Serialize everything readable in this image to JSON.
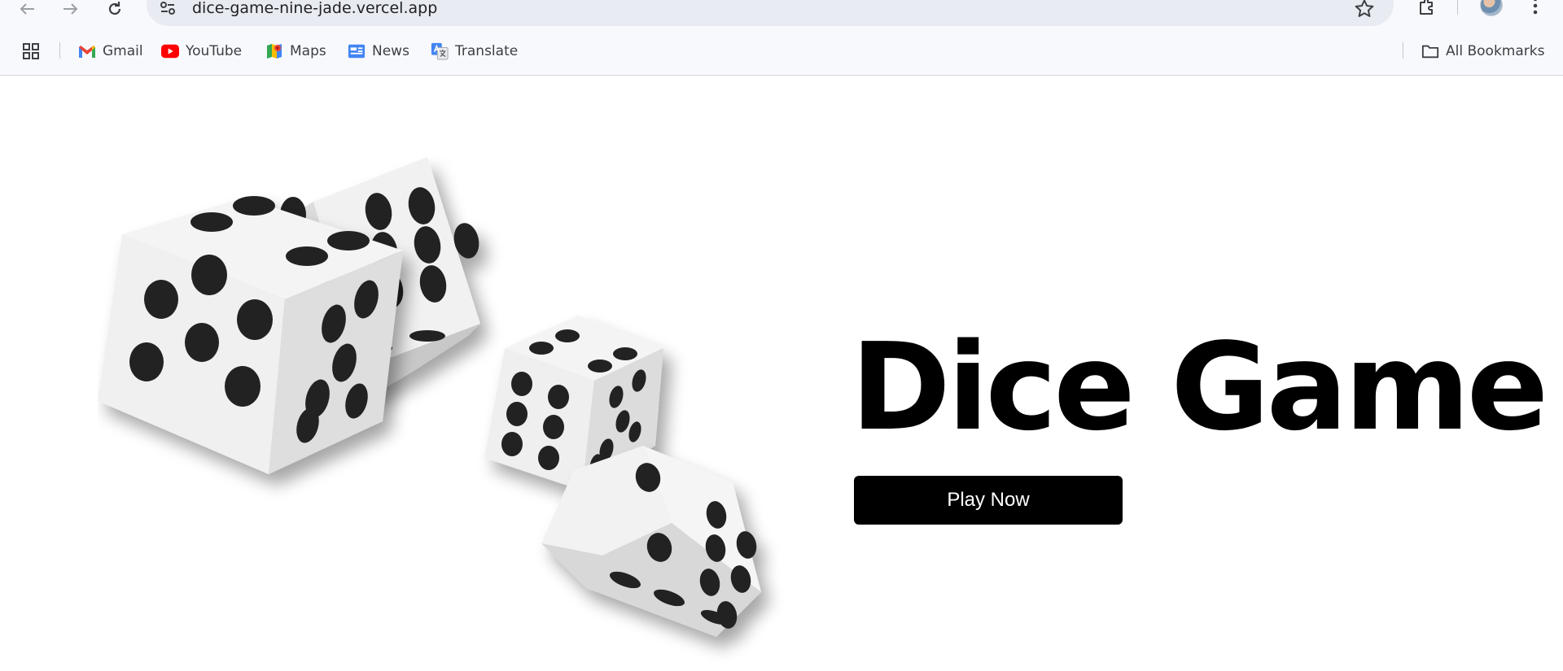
{
  "browser": {
    "url": "dice-game-nine-jade.vercel.app",
    "bookmarks": [
      {
        "label": "Gmail",
        "icon": "gmail-icon"
      },
      {
        "label": "YouTube",
        "icon": "youtube-icon"
      },
      {
        "label": "Maps",
        "icon": "maps-icon"
      },
      {
        "label": "News",
        "icon": "news-icon"
      },
      {
        "label": "Translate",
        "icon": "translate-icon"
      }
    ],
    "all_bookmarks_label": "All Bookmarks",
    "icons": {
      "back": "arrow-back-icon",
      "forward": "arrow-forward-icon",
      "reload": "reload-icon",
      "site_info": "tune-icon",
      "star": "star-icon",
      "extensions": "puzzle-icon",
      "menu": "kebab-menu-icon",
      "apps": "apps-grid-icon",
      "folder": "folder-icon"
    }
  },
  "page": {
    "title": "Dice Game",
    "play_button_label": "Play Now",
    "hero_image": "dice-illustration"
  },
  "colors": {
    "page_background": "#ffffff",
    "title": "#000000",
    "button_background": "#000000",
    "button_text": "#ffffff",
    "chrome_background": "#f8f9fd",
    "omnibox_background": "#e9ebf2",
    "die_face": "#f2f2f2",
    "pip": "#222222"
  }
}
